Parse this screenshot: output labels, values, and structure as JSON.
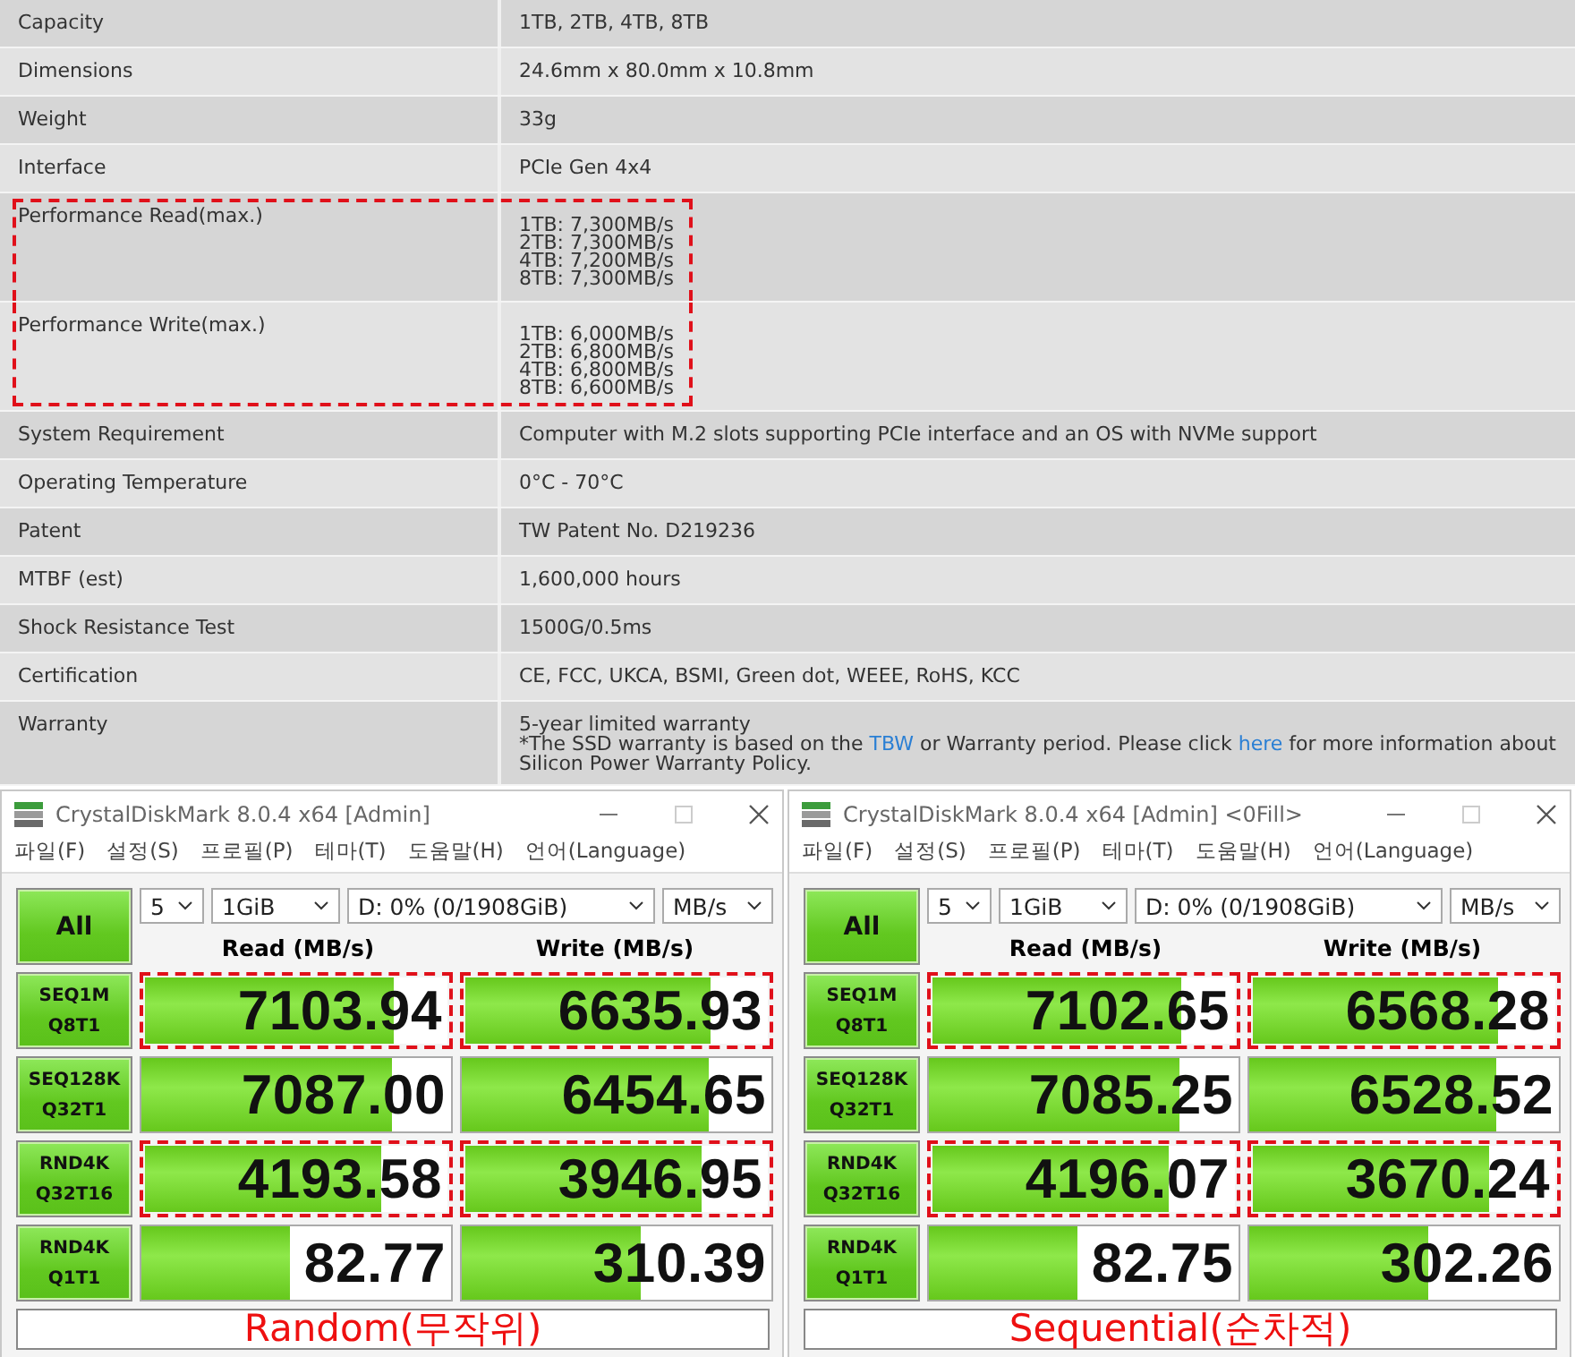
{
  "spec_rows": [
    {
      "label": "Capacity",
      "lines": [
        "1TB, 2TB, 4TB, 8TB"
      ],
      "highlighted": false
    },
    {
      "label": "Dimensions",
      "lines": [
        "24.6mm x 80.0mm x 10.8mm"
      ],
      "highlighted": false
    },
    {
      "label": "Weight",
      "lines": [
        "33g"
      ],
      "highlighted": false
    },
    {
      "label": "Interface",
      "lines": [
        "PCIe Gen 4x4"
      ],
      "highlighted": false
    },
    {
      "label": "Performance Read(max.)",
      "lines": [
        "1TB: 7,300MB/s",
        "2TB: 7,300MB/s",
        "4TB: 7,200MB/s",
        "8TB: 7,300MB/s"
      ],
      "highlighted": true
    },
    {
      "label": "Performance Write(max.)",
      "lines": [
        "1TB: 6,000MB/s",
        "2TB: 6,800MB/s",
        "4TB: 6,800MB/s",
        "8TB: 6,600MB/s"
      ],
      "highlighted": true
    },
    {
      "label": "System Requirement",
      "lines": [
        "Computer with M.2 slots supporting PCIe interface and an OS with NVMe support"
      ],
      "highlighted": false
    },
    {
      "label": "Operating Temperature",
      "lines": [
        "0°C - 70°C"
      ],
      "highlighted": false
    },
    {
      "label": "Patent",
      "lines": [
        "TW Patent No. D219236"
      ],
      "highlighted": false
    },
    {
      "label": "MTBF (est)",
      "lines": [
        "1,600,000 hours"
      ],
      "highlighted": false
    },
    {
      "label": "Shock Resistance Test",
      "lines": [
        "1500G/0.5ms"
      ],
      "highlighted": false
    },
    {
      "label": "Certification",
      "lines": [
        "CE, FCC, UKCA, BSMI, Green dot, WEEE, RoHS, KCC"
      ],
      "highlighted": false
    },
    {
      "label": "Warranty",
      "lines": [
        "5-year limited warranty"
      ],
      "note": [
        {
          "kind": "text",
          "text": "*The SSD warranty is based on the "
        },
        {
          "kind": "link",
          "text": "TBW"
        },
        {
          "kind": "text",
          "text": " or Warranty period. Please click "
        },
        {
          "kind": "link",
          "text": "here"
        },
        {
          "kind": "text",
          "text": " for more information about Silicon Power Warranty Policy."
        }
      ],
      "highlighted": false
    }
  ],
  "benchmarks": [
    {
      "title": "CrystalDiskMark 8.0.4 x64 [Admin]",
      "menu": [
        "파일(F)",
        "설정(S)",
        "프로필(P)",
        "테마(T)",
        "도움말(H)",
        "언어(Language)"
      ],
      "all_label": "All",
      "count": "5",
      "size": "1GiB",
      "drive": "D: 0% (0/1908GiB)",
      "unit": "MB/s",
      "read_header": "Read (MB/s)",
      "write_header": "Write (MB/s)",
      "rows": [
        {
          "test": [
            "SEQ1M",
            "Q8T1"
          ],
          "read": {
            "value": "7103.94",
            "level": 0.81,
            "highlighted": true
          },
          "write": {
            "value": "6635.93",
            "level": 0.8,
            "highlighted": true
          }
        },
        {
          "test": [
            "SEQ128K",
            "Q32T1"
          ],
          "read": {
            "value": "7087.00",
            "level": 0.81,
            "highlighted": false
          },
          "write": {
            "value": "6454.65",
            "level": 0.8,
            "highlighted": false
          }
        },
        {
          "test": [
            "RND4K",
            "Q32T16"
          ],
          "read": {
            "value": "4193.58",
            "level": 0.77,
            "highlighted": true
          },
          "write": {
            "value": "3946.95",
            "level": 0.77,
            "highlighted": true
          }
        },
        {
          "test": [
            "RND4K",
            "Q1T1"
          ],
          "read": {
            "value": "82.77",
            "level": 0.48,
            "highlighted": false
          },
          "write": {
            "value": "310.39",
            "level": 0.58,
            "highlighted": false
          }
        }
      ],
      "comment": "Random(무작위)"
    },
    {
      "title": "CrystalDiskMark 8.0.4 x64 [Admin] <0Fill>",
      "menu": [
        "파일(F)",
        "설정(S)",
        "프로필(P)",
        "테마(T)",
        "도움말(H)",
        "언어(Language)"
      ],
      "all_label": "All",
      "count": "5",
      "size": "1GiB",
      "drive": "D: 0% (0/1908GiB)",
      "unit": "MB/s",
      "read_header": "Read (MB/s)",
      "write_header": "Write (MB/s)",
      "rows": [
        {
          "test": [
            "SEQ1M",
            "Q8T1"
          ],
          "read": {
            "value": "7102.65",
            "level": 0.81,
            "highlighted": true
          },
          "write": {
            "value": "6568.28",
            "level": 0.8,
            "highlighted": true
          }
        },
        {
          "test": [
            "SEQ128K",
            "Q32T1"
          ],
          "read": {
            "value": "7085.25",
            "level": 0.81,
            "highlighted": false
          },
          "write": {
            "value": "6528.52",
            "level": 0.8,
            "highlighted": false
          }
        },
        {
          "test": [
            "RND4K",
            "Q32T16"
          ],
          "read": {
            "value": "4196.07",
            "level": 0.77,
            "highlighted": true
          },
          "write": {
            "value": "3670.24",
            "level": 0.77,
            "highlighted": true
          }
        },
        {
          "test": [
            "RND4K",
            "Q1T1"
          ],
          "read": {
            "value": "82.75",
            "level": 0.48,
            "highlighted": false
          },
          "write": {
            "value": "302.26",
            "level": 0.58,
            "highlighted": false
          }
        }
      ],
      "comment": "Sequential(순차적)"
    }
  ]
}
